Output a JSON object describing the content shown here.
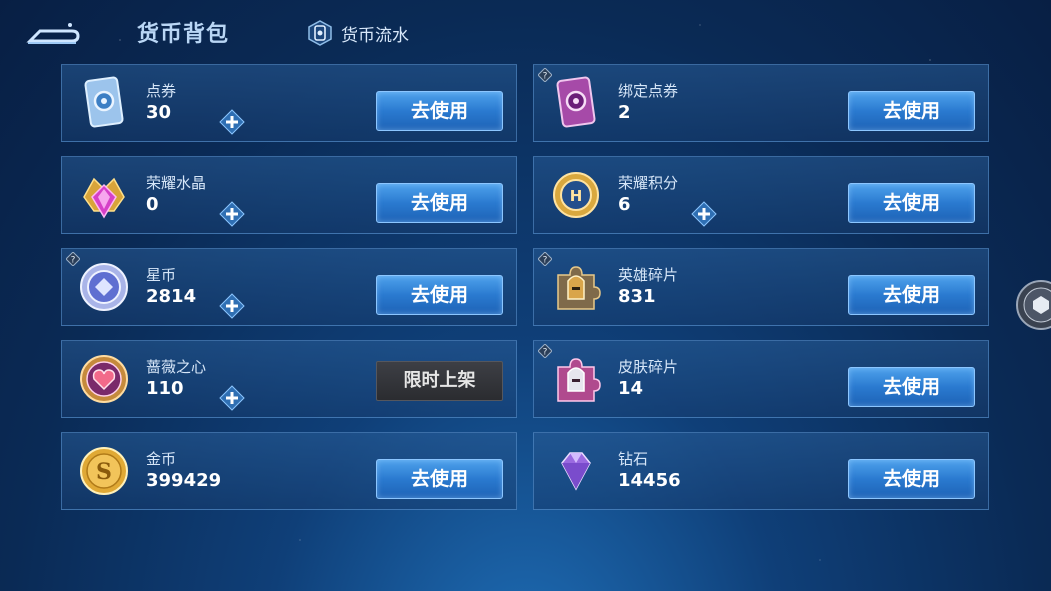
{
  "header": {
    "title": "货币背包",
    "flow_label": "货币流水"
  },
  "labels": {
    "use": "去使用",
    "limited": "限时上架"
  },
  "colors": {
    "button_blue": "#2a7ad0",
    "panel_border": "#5c96d2",
    "limited_gray": "#3d3f45"
  },
  "currencies": [
    {
      "name": "点券",
      "amount": "30",
      "icon": "coupon-card-icon",
      "plus": true,
      "badge": false,
      "action": "use"
    },
    {
      "name": "绑定点券",
      "amount": "2",
      "icon": "bound-coupon-card-icon",
      "plus": false,
      "badge": true,
      "action": "use"
    },
    {
      "name": "荣耀水晶",
      "amount": "0",
      "icon": "glory-crystal-icon",
      "plus": true,
      "badge": false,
      "action": "use"
    },
    {
      "name": "荣耀积分",
      "amount": "6",
      "icon": "glory-points-icon",
      "plus": true,
      "badge": false,
      "action": "use"
    },
    {
      "name": "星币",
      "amount": "2814",
      "icon": "star-coin-icon",
      "plus": true,
      "badge": true,
      "action": "use"
    },
    {
      "name": "英雄碎片",
      "amount": "831",
      "icon": "hero-fragment-icon",
      "plus": false,
      "badge": true,
      "action": "use"
    },
    {
      "name": "蔷薇之心",
      "amount": "110",
      "icon": "rose-heart-icon",
      "plus": true,
      "badge": false,
      "action": "limited"
    },
    {
      "name": "皮肤碎片",
      "amount": "14",
      "icon": "skin-fragment-icon",
      "plus": false,
      "badge": true,
      "action": "use"
    },
    {
      "name": "金币",
      "amount": "399429",
      "icon": "gold-coin-icon",
      "plus": false,
      "badge": false,
      "action": "use"
    },
    {
      "name": "钻石",
      "amount": "14456",
      "icon": "diamond-icon",
      "plus": false,
      "badge": false,
      "action": "use"
    }
  ]
}
